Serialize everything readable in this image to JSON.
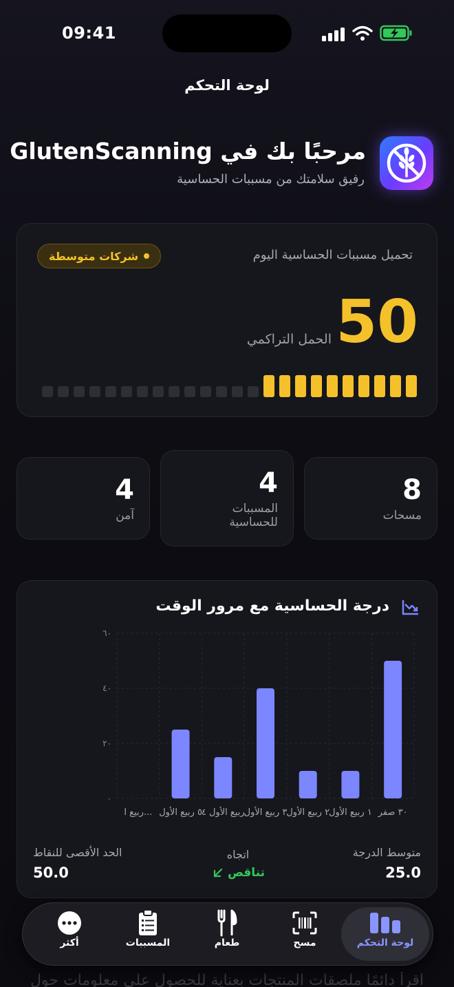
{
  "status_bar": {
    "time": "09:41"
  },
  "nav": {
    "title": "لوحة التحكم"
  },
  "header": {
    "welcome": "مرحبًا بك في GlutenScanning",
    "subtitle": "رفيق سلامتك من مسببات الحساسية",
    "app_icon": "crossed-wheat-icon"
  },
  "load_card": {
    "title": "تحميل مسببات الحساسية اليوم",
    "badge": "شركات متوسطة",
    "value": "50",
    "value_label": "الحمل التراكمي",
    "segments_total": 24,
    "segments_filled": 10,
    "accent": "#f4c12b"
  },
  "stats": [
    {
      "value": "8",
      "label": "مسحات"
    },
    {
      "value": "4",
      "label": "المسببات للحساسية"
    },
    {
      "value": "4",
      "label": "آمن"
    }
  ],
  "chart": {
    "title": "درجة الحساسية مع مرور الوقت",
    "icon": "trend-chart-icon",
    "bar_color": "#7b86ff"
  },
  "chart_data": {
    "type": "bar",
    "categories": [
      "٣٠ صفر",
      "١ ربيع الأول",
      "٢ ربيع الأول",
      "٣ ربيع الأول",
      "ربيع الأول ٤",
      "٥ ربيع الأول",
      "ربيع ا..."
    ],
    "values": [
      50,
      10,
      10,
      40,
      15,
      25,
      0
    ],
    "y_ticks": [
      "٠",
      "٢٠",
      "٤٠",
      "٦٠"
    ],
    "ylim": [
      0,
      60
    ],
    "grid": true
  },
  "summary": {
    "avg_label": "متوسط الدرجة",
    "avg_value": "25.0",
    "trend_label": "اتجاه",
    "trend_value": "تناقص",
    "trend_icon": "arrow-down-left-icon",
    "max_label": "الحد الأقصى للنقاط",
    "max_value": "50.0"
  },
  "tabs": [
    {
      "label": "لوحة التحكم",
      "icon": "dashboard-icon",
      "active": true
    },
    {
      "label": "مسح",
      "icon": "barcode-scan-icon",
      "active": false
    },
    {
      "label": "طعام",
      "icon": "fork-knife-icon",
      "active": false
    },
    {
      "label": "المسببات",
      "icon": "clipboard-icon",
      "active": false
    },
    {
      "label": "أكثر",
      "icon": "more-icon",
      "active": false
    }
  ],
  "footer_text": "اقرأ دائمًا ملصقات المنتجات بعناية للحصول على معلومات حول"
}
